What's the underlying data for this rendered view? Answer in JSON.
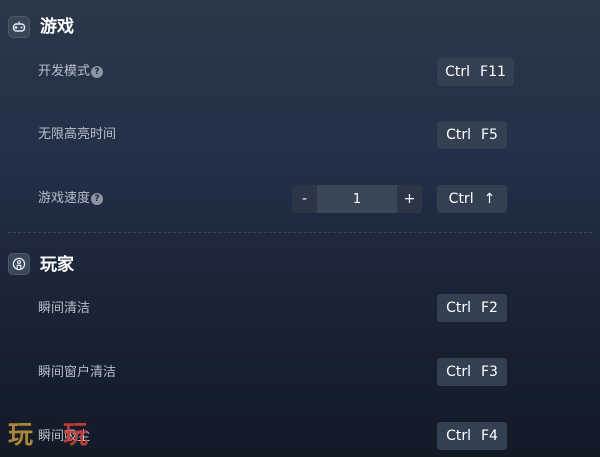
{
  "sections": {
    "game": {
      "title": "游戏",
      "icon": "gamepad-icon",
      "rows": [
        {
          "label": "开发模式",
          "help": true,
          "keys": [
            "Ctrl",
            "F11"
          ]
        },
        {
          "label": "无限高亮时间",
          "help": false,
          "keys": [
            "Ctrl",
            "F5"
          ]
        },
        {
          "label": "游戏速度",
          "help": true,
          "keys": [
            "Ctrl",
            "↑"
          ],
          "stepper": {
            "minus": "-",
            "value": "1",
            "plus": "+"
          }
        }
      ]
    },
    "player": {
      "title": "玩家",
      "icon": "player-icon",
      "rows": [
        {
          "label": "瞬间清洁",
          "keys": [
            "Ctrl",
            "F2"
          ]
        },
        {
          "label": "瞬间窗户清洁",
          "keys": [
            "Ctrl",
            "F3"
          ]
        },
        {
          "label": "瞬间吸尘",
          "keys": [
            "Ctrl",
            "F4"
          ]
        }
      ]
    }
  },
  "help_glyph": "?",
  "watermark": {
    "left": "玩",
    "right": "玩"
  },
  "colors": {
    "background_top": "#2a3849",
    "background_bottom": "#121a26",
    "hotkey_bg": "#334052",
    "watermark_gold": "#c89a3a",
    "watermark_red": "#d8423a"
  }
}
